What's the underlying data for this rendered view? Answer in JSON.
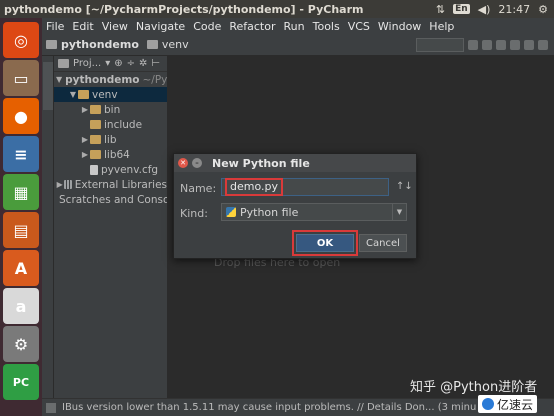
{
  "topbar": {
    "title": "pythondemo [~/PycharmProjects/pythondemo] - PyCharm",
    "keyboard_layout": "En",
    "time": "21:47"
  },
  "launcher": {
    "apps": [
      {
        "name": "ubuntu-dash-icon",
        "color": "#dd4814",
        "glyph": "◎"
      },
      {
        "name": "file-manager-icon",
        "color": "#8a6a4e",
        "glyph": "▭"
      },
      {
        "name": "firefox-icon",
        "color": "#e66000",
        "glyph": "●"
      },
      {
        "name": "libreoffice-writer-icon",
        "color": "#3b6ea5",
        "glyph": "≡"
      },
      {
        "name": "libreoffice-calc-icon",
        "color": "#4a9c3c",
        "glyph": "▦"
      },
      {
        "name": "libreoffice-impress-icon",
        "color": "#c9591c",
        "glyph": "▤"
      },
      {
        "name": "software-center-icon",
        "color": "#d95b1e",
        "glyph": "A"
      },
      {
        "name": "amazon-icon",
        "color": "#d9d9d9",
        "glyph": "a"
      },
      {
        "name": "system-settings-icon",
        "color": "#7a7a7a",
        "glyph": "⚙"
      },
      {
        "name": "pycharm-icon",
        "color": "#2f9e44",
        "glyph": "PC"
      }
    ]
  },
  "menubar": {
    "items": [
      "File",
      "Edit",
      "View",
      "Navigate",
      "Code",
      "Refactor",
      "Run",
      "Tools",
      "VCS",
      "Window",
      "Help"
    ]
  },
  "navbar": {
    "crumbs": [
      "pythondemo",
      "venv"
    ]
  },
  "project_panel": {
    "toolbar_label": "Proj...",
    "tree": [
      {
        "label": "pythondemo",
        "suffix": "~/Pych",
        "indent": 0,
        "arrow": "▼",
        "icon": "gray",
        "selected": false,
        "bold": true
      },
      {
        "label": "venv",
        "suffix": "",
        "indent": 1,
        "arrow": "▼",
        "icon": "orange",
        "selected": true,
        "bold": false
      },
      {
        "label": "bin",
        "suffix": "",
        "indent": 2,
        "arrow": "▶",
        "icon": "orange",
        "selected": false,
        "bold": false
      },
      {
        "label": "include",
        "suffix": "",
        "indent": 2,
        "arrow": "",
        "icon": "orange",
        "selected": false,
        "bold": false
      },
      {
        "label": "lib",
        "suffix": "",
        "indent": 2,
        "arrow": "▶",
        "icon": "orange",
        "selected": false,
        "bold": false
      },
      {
        "label": "lib64",
        "suffix": "",
        "indent": 2,
        "arrow": "▶",
        "icon": "orange",
        "selected": false,
        "bold": false
      },
      {
        "label": "pyvenv.cfg",
        "suffix": "",
        "indent": 2,
        "arrow": "",
        "icon": "file",
        "selected": false,
        "bold": false
      },
      {
        "label": "External Libraries",
        "suffix": "",
        "indent": 0,
        "arrow": "▶",
        "icon": "bars",
        "selected": false,
        "bold": false
      },
      {
        "label": "Scratches and Consol",
        "suffix": "",
        "indent": 0,
        "arrow": "",
        "icon": "gray",
        "selected": false,
        "bold": false
      }
    ]
  },
  "editor": {
    "drop_hint": "Drop files here to open"
  },
  "dialog": {
    "title": "New Python file",
    "name_label": "Name:",
    "name_value": "demo.py",
    "kind_label": "Kind:",
    "kind_value": "Python file",
    "ok_label": "OK",
    "cancel_label": "Cancel"
  },
  "statusbar": {
    "message": "IBus version lower than 1.5.11 may cause input problems. // Details Don... (3 minu"
  },
  "watermark": {
    "text": "知乎 @Python进阶者",
    "brand": "亿速云"
  }
}
